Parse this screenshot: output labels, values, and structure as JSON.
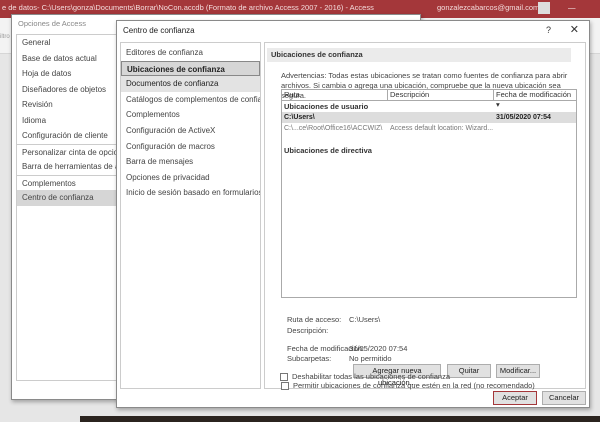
{
  "app": {
    "title": "e de datos- C:\\Users\\gonza\\Documents\\Borrar\\NoCon.accdb (Formato de archivo Access 2007 - 2016)  -  Access",
    "account": "gonzalezcabarcos@gmail.com",
    "ribbon_filter": "iltro"
  },
  "options_dialog": {
    "title": "Opciones de Access",
    "nav": [
      "General",
      "Base de datos actual",
      "Hoja de datos",
      "Diseñadores de objetos",
      "Revisión",
      "Idioma",
      "Configuración de cliente",
      "Personalizar cinta de opciones",
      "Barra de herramientas de acceso rápido",
      "Complementos",
      "Centro de confianza"
    ]
  },
  "trust_center": {
    "title": "Centro de confianza",
    "help": "?",
    "close": "✕",
    "nav": [
      "Editores de confianza",
      "Ubicaciones de confianza",
      "Documentos de confianza",
      "Catálogos de complementos de confianza",
      "Complementos",
      "Configuración de ActiveX",
      "Configuración de macros",
      "Barra de mensajes",
      "Opciones de privacidad",
      "Inicio de sesión basado en formularios"
    ],
    "section_title": "Ubicaciones de confianza",
    "warning": "Advertencias: Todas estas ubicaciones se tratan como fuentes de confianza para abrir archivos. Si cambia o agrega una ubicación, compruebe que la nueva ubicación sea segura.",
    "columns": [
      "Ruta",
      "Descripción",
      "Fecha de modificación ▾"
    ],
    "user_group": "Ubicaciones de usuario",
    "rows": [
      {
        "path": "C:\\Users\\",
        "desc": "",
        "date": "31/05/2020 07:54"
      },
      {
        "path": "C:\\...ce\\Root\\Office16\\ACCWIZ\\",
        "desc": "Access default location: Wizard...",
        "date": ""
      }
    ],
    "policy_group": "Ubicaciones de directiva",
    "details": {
      "path_label": "Ruta de acceso:",
      "path_value": "C:\\Users\\",
      "desc_label": "Descripción:",
      "date_label": "Fecha de modificación:",
      "date_value": "31/05/2020 07:54",
      "sub_label": "Subcarpetas:",
      "sub_value": "No permitido"
    },
    "buttons": {
      "add": "Agregar nueva ubicación...",
      "remove": "Quitar",
      "modify": "Modificar...",
      "ok": "Aceptar",
      "cancel": "Cancelar"
    },
    "checkboxes": [
      "Permitir ubicaciones de confianza que estén en la red (no recomendado)",
      "Deshabilitar todas las ubicaciones de confianza"
    ]
  }
}
